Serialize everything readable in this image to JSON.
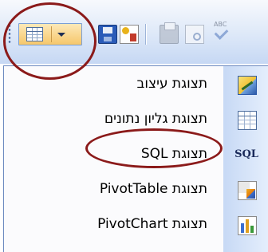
{
  "toolbar": {
    "view_button": {
      "icon": "datasheet-view-icon",
      "dropdown_icon": "chevron-down-icon"
    },
    "buttons": [
      "save-icon",
      "file-permission-icon",
      "print-icon",
      "print-preview-icon",
      "spelling-icon"
    ],
    "spelling_icon_text": "ABC"
  },
  "menu": {
    "items": [
      {
        "label": "תצוגת עיצוב",
        "icon": "design-view-icon"
      },
      {
        "label": "תצוגת גליון נתונים",
        "icon": "datasheet-view-icon"
      },
      {
        "label": "תצוגת SQL",
        "icon": "sql-view-icon",
        "icon_text": "SQL"
      },
      {
        "label": "תצוגת PivotTable",
        "icon": "pivottable-view-icon"
      },
      {
        "label": "תצוגת PivotChart",
        "icon": "pivotchart-view-icon"
      }
    ]
  },
  "annotations": {
    "color": "#8b1a1a",
    "highlighted": [
      "view-dropdown-button",
      "menu-item-sql-view"
    ]
  },
  "colors": {
    "toolbar_gradient_top": "#f7f9fd",
    "toolbar_gradient_bottom": "#c6d8f4",
    "active_button": "#f6c76a",
    "menu_gutter": "#c7d9f5"
  }
}
